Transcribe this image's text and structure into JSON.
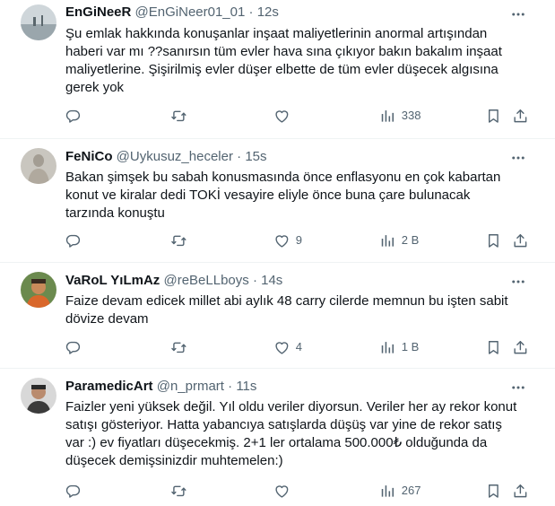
{
  "colors": {
    "text": "#0f1419",
    "secondary": "#536471",
    "divider": "#eff3f4"
  },
  "tweets": [
    {
      "name": "EnGiNeeR",
      "handle": "@EnGiNeer01_01",
      "dot": "·",
      "time": "12s",
      "lines": [
        "Şu emlak hakkında konuşanlar inşaat maliyetlerinin anormal artışından",
        "haberi var mı ??sanırsın tüm evler hava sına çıkıyor bakın bakalım inşaat",
        "maliyetlerine. Şişirilmiş evler düşer elbette de tüm evler düşecek algısına",
        "gerek yok"
      ],
      "likes": "",
      "views": "338"
    },
    {
      "name": "FeNiCo",
      "handle": "@Uykusuz_heceler",
      "dot": "·",
      "time": "15s",
      "lines": [
        "Bakan şimşek bu sabah konusmasında önce enflasyonu en çok kabartan",
        "konut ve kiralar dedi TOKİ vesayire eliyle önce buna çare bulunacak",
        "tarzında konuştu"
      ],
      "likes": "9",
      "views": "2 B"
    },
    {
      "name": "VaRoL YıLmAz",
      "handle": "@reBeLLboys",
      "dot": "·",
      "time": "14s",
      "lines": [
        "Faize devam edicek millet abi aylık 48 carry cilerde memnun bu işten sabit",
        "dövize devam"
      ],
      "likes": "4",
      "views": "1 B"
    },
    {
      "name": "ParamedicArt",
      "handle": "@n_prmart",
      "dot": "·",
      "time": "11s",
      "lines": [
        "Faizler yeni yüksek değil. Yıl oldu veriler diyorsun. Veriler her ay rekor konut",
        "satışı gösteriyor. Hatta yabancıya satışlarda düşüş var yine de rekor satış",
        "var :) ev fiyatları düşecekmiş. 2+1 ler ortalama 500.000₺ olduğunda da",
        "düşecek demişsinizdir muhtemelen:)"
      ],
      "likes": "",
      "views": "267"
    }
  ]
}
